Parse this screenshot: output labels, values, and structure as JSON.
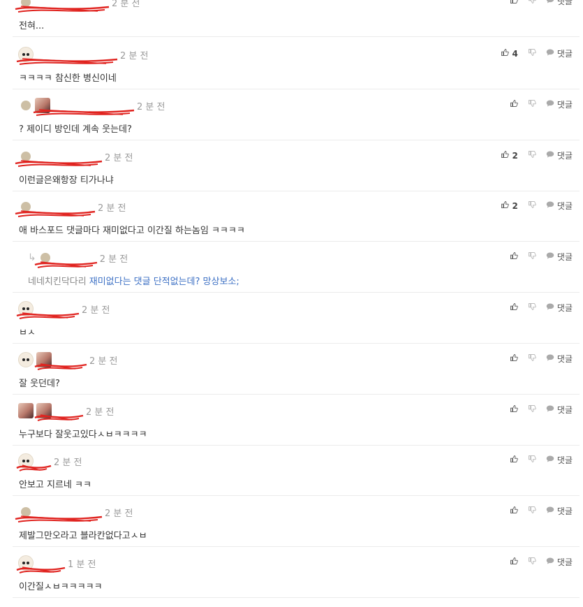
{
  "actions": {
    "reply_label": "댓글"
  },
  "comments": [
    {
      "name": "",
      "time": "2 분 전",
      "body": "전혀...",
      "likes": "",
      "reply": false,
      "avatar": "dot"
    },
    {
      "name": "",
      "time": "2 분 전",
      "body": "ㅋㅋㅋㅋ 참신한 병신이네",
      "likes": "4",
      "reply": false,
      "avatar": "dog"
    },
    {
      "name": "",
      "time": "2 분 전",
      "body": "? 제이디 방인데 계속 웃는데?",
      "likes": "",
      "reply": false,
      "avatar": "dot+photo"
    },
    {
      "name": "",
      "time": "2 분 전",
      "body": "이런글은왜항장 티가나냐",
      "likes": "2",
      "reply": false,
      "avatar": "dot"
    },
    {
      "name": "",
      "time": "2 분 전",
      "body": "애 바스포드 댓글마다 재미없다고 이간질 하는놈임 ㅋㅋㅋㅋ",
      "likes": "2",
      "reply": false,
      "avatar": "dot"
    },
    {
      "name": "",
      "time": "2 분 전",
      "mention": "네네치킨닥다리",
      "body": "재미없다는 댓글 단적없는데? 망상보소;",
      "likes": "",
      "reply": true,
      "avatar": "dot"
    },
    {
      "name": "",
      "time": "2 분 전",
      "body": "ㅂㅅ",
      "likes": "",
      "reply": false,
      "avatar": "dog"
    },
    {
      "name": "",
      "time": "2 분 전",
      "body": "잘 웃던데?",
      "likes": "",
      "reply": false,
      "avatar": "dog+photo"
    },
    {
      "name": "",
      "time": "2 분 전",
      "body": "누구보다 잘웃고있다ㅅㅂㅋㅋㅋㅋ",
      "likes": "",
      "reply": false,
      "avatar": "photo+photo"
    },
    {
      "name": "",
      "time": "2 분 전",
      "body": "안보고 지르네 ㅋㅋ",
      "likes": "",
      "reply": false,
      "avatar": "dog"
    },
    {
      "name": "",
      "time": "2 분 전",
      "body": "제발그만오라고 블라칸없다고ㅅㅂ",
      "likes": "",
      "reply": false,
      "avatar": "dot"
    },
    {
      "name": "",
      "time": "1 분 전",
      "body": "이간질ㅅㅂㅋㅋㅋㅋㅋ",
      "likes": "",
      "reply": false,
      "avatar": "dog"
    }
  ]
}
